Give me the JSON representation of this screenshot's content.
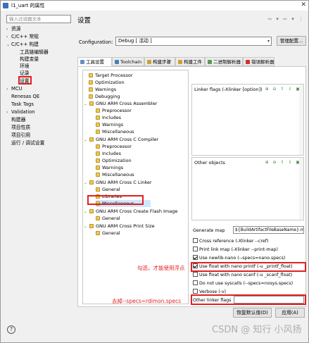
{
  "window": {
    "title": "l1_uart 的属性",
    "close": "✕"
  },
  "filter": {
    "placeholder": "输入过滤器文本"
  },
  "nav": [
    {
      "label": "资源",
      "arrow": "›"
    },
    {
      "label": "C/C++ 常规",
      "arrow": "›"
    },
    {
      "label": "C/C++ 构建",
      "arrow": "⌄"
    },
    {
      "label": "工具链编辑器",
      "arrow": ""
    },
    {
      "label": "构建变量",
      "arrow": ""
    },
    {
      "label": "环境",
      "arrow": ""
    },
    {
      "label": "记录",
      "arrow": ""
    },
    {
      "label": "设置",
      "arrow": ""
    },
    {
      "label": "MCU",
      "arrow": "›"
    },
    {
      "label": "Renesas QE",
      "arrow": ""
    },
    {
      "label": "Task Tags",
      "arrow": ""
    },
    {
      "label": "Validation",
      "arrow": "›"
    },
    {
      "label": "构建器",
      "arrow": ""
    },
    {
      "label": "项目性质",
      "arrow": ""
    },
    {
      "label": "项目引用",
      "arrow": ""
    },
    {
      "label": "运行 / 调试设置",
      "arrow": ""
    }
  ],
  "page": {
    "title": "设置",
    "arrows": "⇦ ▾ ⇨ ▾ ⋮"
  },
  "config": {
    "label": "Configuration:",
    "value": "Debug [ 活动 ]",
    "dropdown": "▾",
    "manage_label": "管理配置..."
  },
  "tabs": [
    {
      "label": "工具设置",
      "icon": "tools-icon",
      "color": "#6a8fc4"
    },
    {
      "label": "Toolchain",
      "icon": "toolchain-icon",
      "color": "#4a7fb8"
    },
    {
      "label": "构建步骤",
      "icon": "steps-icon",
      "color": "#c8a040"
    },
    {
      "label": "构建工件",
      "icon": "artifact-icon",
      "color": "#d0a030"
    },
    {
      "label": "二进制解析器",
      "icon": "binary-icon",
      "color": "#5a9a5a"
    },
    {
      "label": "错误解析器",
      "icon": "error-icon",
      "color": "#d03030"
    }
  ],
  "tool_tree": [
    {
      "label": "Target Processor",
      "level": 1,
      "arrow": ""
    },
    {
      "label": "Optimization",
      "level": 1,
      "arrow": ""
    },
    {
      "label": "Warnings",
      "level": 1,
      "arrow": ""
    },
    {
      "label": "Debugging",
      "level": 1,
      "arrow": ""
    },
    {
      "label": "GNU ARM Cross Assembler",
      "level": 0,
      "arrow": "⌄"
    },
    {
      "label": "Preprocessor",
      "level": 2,
      "arrow": ""
    },
    {
      "label": "Includes",
      "level": 2,
      "arrow": ""
    },
    {
      "label": "Warnings",
      "level": 2,
      "arrow": ""
    },
    {
      "label": "Miscellaneous",
      "level": 2,
      "arrow": ""
    },
    {
      "label": "GNU ARM Cross C Compiler",
      "level": 0,
      "arrow": "⌄"
    },
    {
      "label": "Preprocessor",
      "level": 2,
      "arrow": ""
    },
    {
      "label": "Includes",
      "level": 2,
      "arrow": ""
    },
    {
      "label": "Optimization",
      "level": 2,
      "arrow": ""
    },
    {
      "label": "Warnings",
      "level": 2,
      "arrow": ""
    },
    {
      "label": "Miscellaneous",
      "level": 2,
      "arrow": ""
    },
    {
      "label": "GNU ARM Cross C Linker",
      "level": 0,
      "arrow": "⌄"
    },
    {
      "label": "General",
      "level": 2,
      "arrow": ""
    },
    {
      "label": "Libraries",
      "level": 2,
      "arrow": ""
    },
    {
      "label": "Miscellaneous",
      "level": 2,
      "arrow": "",
      "selected": true
    },
    {
      "label": "GNU ARM Cross Create Flash Image",
      "level": 0,
      "arrow": "⌄"
    },
    {
      "label": "General",
      "level": 2,
      "arrow": ""
    },
    {
      "label": "GNU ARM Cross Print Size",
      "level": 0,
      "arrow": "⌄"
    },
    {
      "label": "General",
      "level": 2,
      "arrow": ""
    }
  ],
  "linker_flags": {
    "label": "Linker flags (-Xlinker [option])",
    "tools": "⊕ ⊖ ⇧ ⇩ ▣"
  },
  "other_objects": {
    "label": "Other objects",
    "tools": "⊕ ⊖ ⇧ ⇩ ▣"
  },
  "generate_map": {
    "label": "Generate map",
    "value": "${BuildArtifactFileBaseName}.map"
  },
  "options": [
    {
      "label": "Cross reference (-Xlinker --cref)",
      "checked": false
    },
    {
      "label": "Print link map (-Xlinker --print-map)",
      "checked": false
    },
    {
      "label": "Use newlib-nano (--specs=nano.specs)",
      "checked": true
    },
    {
      "label": "Use float with nano printf (-u _printf_float)",
      "checked": true
    },
    {
      "label": "Use float with nano scanf (-u _scanf_float)",
      "checked": false
    },
    {
      "label": "Do not use syscalls (--specs=nosys.specs)",
      "checked": false
    },
    {
      "label": "Verbose (-v)",
      "checked": false
    }
  ],
  "other_linker_flags": {
    "label": "Other linker flags",
    "value": ""
  },
  "annotations": {
    "check_note": "勾选，才能使用浮点",
    "remove_note": "去掉--specs=rdimon.specs"
  },
  "buttons": {
    "restore": "恢复默认值(D)",
    "apply": "应用(A)"
  },
  "watermark": "CSDN @ 知行 小风扬",
  "help_icon": "?"
}
